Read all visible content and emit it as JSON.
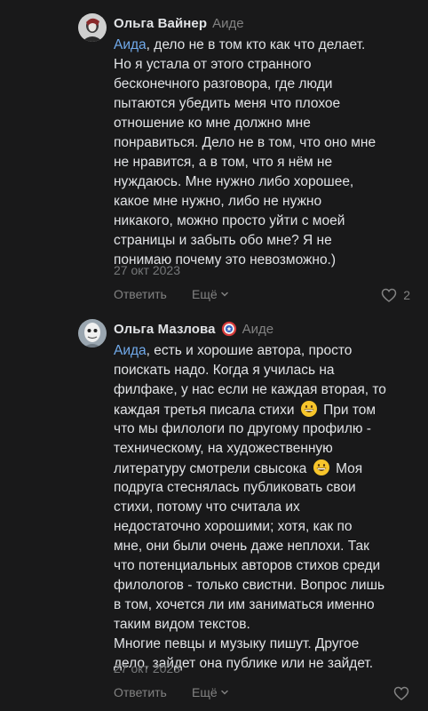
{
  "comments": [
    {
      "author": "Ольга Вайнер",
      "reply_to": "Аиде",
      "mention": "Аида",
      "lines": [
        ", дело не в том кто как что делает.",
        "Но я устала от этого странного",
        "бесконечного разговора, где люди",
        "пытаются убедить меня что плохое",
        "отношение ко мне должно мне",
        "понравиться. Дело не в том, что оно мне",
        "не нравится, а в том, что я нём не",
        "нуждаюсь. Мне нужно либо хорошее,",
        "какое мне нужно, либо не нужно",
        "никакого, можно просто уйти с моей",
        "страницы и забыть обо мне? Я не",
        "понимаю почему это невозможно.)"
      ],
      "date": "27 окт 2023",
      "reply_label": "Ответить",
      "more_label": "Ещё",
      "like_count": "2"
    },
    {
      "author": "Ольга Мазлова",
      "reply_to": "Аиде",
      "mention": "Аида",
      "lines": [
        ", есть и хорошие автора, просто",
        "поискать надо. Когда я училась на",
        "филфаке, у нас если не каждая вторая, то",
        "каждая третья писала стихи",
        "При том",
        "что мы филологи по другому профилю -",
        "техническому, на художественную",
        "литературу смотрели свысока",
        "Моя",
        "подруга стеснялась публиковать свои",
        "стихи, потому что считала их",
        "недостаточно хорошими; хотя, как по",
        "мне, они были очень даже неплохи. Так",
        "что потенциальных авторов стихов среди",
        "филологов - только свистни. Вопрос лишь",
        "в том, хочется ли им заниматься именно",
        "таким видом текстов.",
        "Многие певцы и музыку пишут. Другое",
        "дело, зайдет она публике или не зайдет."
      ],
      "date": "27 окт 2023",
      "reply_label": "Ответить",
      "more_label": "Ещё"
    }
  ],
  "icons": {
    "heart": "heart-outline-icon",
    "more": "chevron-down-icon",
    "emoji": "grinning-face-emoji",
    "badge": "captain-shield-badge-icon"
  },
  "colors": {
    "background": "#19191a",
    "mention": "#71aaeb",
    "text": "#e1e3e6",
    "muted": "#828282"
  }
}
